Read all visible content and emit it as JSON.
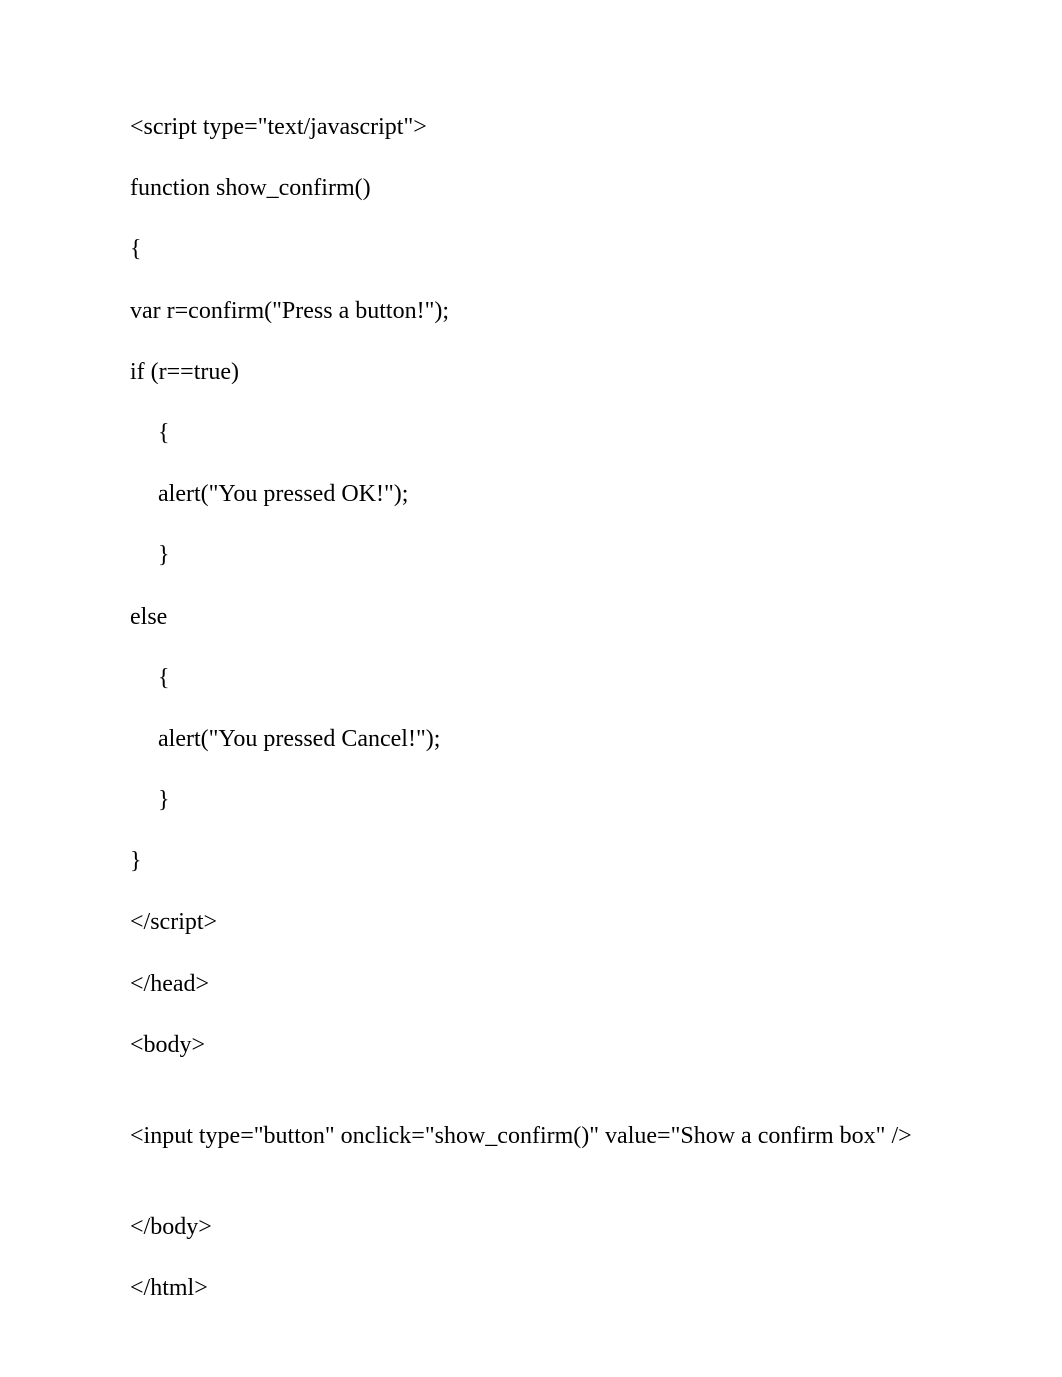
{
  "lines": {
    "l1": "<script type=\"text/javascript\">",
    "l2": "function show_confirm()",
    "l3": "{",
    "l4": "var r=confirm(\"Press a button!\");",
    "l5": "if (r==true)",
    "l6": "{",
    "l7": "alert(\"You pressed OK!\");",
    "l8": "}",
    "l9": "else",
    "l10": "{",
    "l11": "alert(\"You pressed Cancel!\");",
    "l12": "}",
    "l13": "}",
    "l14": "</script>",
    "l15": "</head>",
    "l16": "<body>",
    "l17": "<input type=\"button\" onclick=\"show_confirm()\" value=\"Show a confirm box\" />",
    "l18": "</body>",
    "l19": "</html>"
  }
}
